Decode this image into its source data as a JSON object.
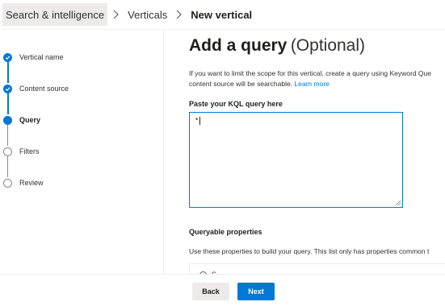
{
  "breadcrumb": {
    "items": [
      "Search & intelligence",
      "Verticals"
    ],
    "current": "New vertical"
  },
  "wizard": {
    "steps": [
      {
        "label": "Vertical name",
        "state": "done"
      },
      {
        "label": "Content source",
        "state": "done"
      },
      {
        "label": "Query",
        "state": "current"
      },
      {
        "label": "Filters",
        "state": "todo"
      },
      {
        "label": "Review",
        "state": "todo"
      }
    ]
  },
  "main": {
    "title": "Add a query",
    "title_suffix": "(Optional)",
    "description_line1": "If you want to limit the scope for this vertical, create a query using Keyword Que",
    "description_line2": "content source will be searchable.",
    "learn_more": "Learn more",
    "kql_label": "Paste your KQL query here",
    "kql_value": "*",
    "queryable_title": "Queryable properties",
    "queryable_desc": "Use these properties to build your query. This list only has properties common t",
    "queryable_first_item": "S"
  },
  "footer": {
    "back_label": "Back",
    "next_label": "Next"
  },
  "colors": {
    "accent": "#0078d4",
    "pending_step": "#8a8886"
  }
}
